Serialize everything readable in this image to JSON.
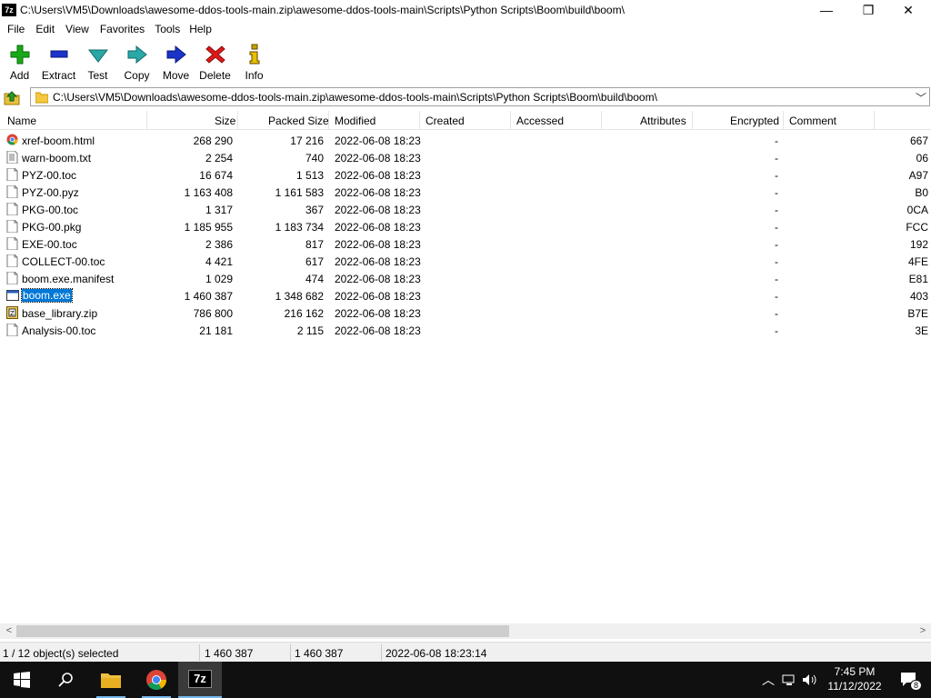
{
  "window": {
    "title": "C:\\Users\\VM5\\Downloads\\awesome-ddos-tools-main.zip\\awesome-ddos-tools-main\\Scripts\\Python Scripts\\Boom\\build\\boom\\",
    "app_icon_text": "7z",
    "minimize": "—",
    "restore": "❐",
    "close": "✕"
  },
  "menu": [
    "File",
    "Edit",
    "View",
    "Favorites",
    "Tools",
    "Help"
  ],
  "toolbar": [
    {
      "label": "Add",
      "icon": "plus-icon",
      "color": "#18a818"
    },
    {
      "label": "Extract",
      "icon": "minus-icon",
      "color": "#1a33c8"
    },
    {
      "label": "Test",
      "icon": "check-icon",
      "color": "#2aa8a8"
    },
    {
      "label": "Copy",
      "icon": "copy-arrow-icon",
      "color": "#2aa8a8"
    },
    {
      "label": "Move",
      "icon": "move-arrow-icon",
      "color": "#1a33c8"
    },
    {
      "label": "Delete",
      "icon": "delete-x-icon",
      "color": "#e01818"
    },
    {
      "label": "Info",
      "icon": "info-icon",
      "color": "#c8a000"
    }
  ],
  "address": {
    "path": "C:\\Users\\VM5\\Downloads\\awesome-ddos-tools-main.zip\\awesome-ddos-tools-main\\Scripts\\Python Scripts\\Boom\\build\\boom\\"
  },
  "columns": [
    "Name",
    "Size",
    "Packed Size",
    "Modified",
    "Created",
    "Accessed",
    "Attributes",
    "Encrypted",
    "Comment"
  ],
  "files": [
    {
      "name": "xref-boom.html",
      "size": "268 290",
      "packed": "17 216",
      "modified": "2022-06-08 18:23",
      "encrypted": "-",
      "crc": "667",
      "icon": "chrome-html-icon"
    },
    {
      "name": "warn-boom.txt",
      "size": "2 254",
      "packed": "740",
      "modified": "2022-06-08 18:23",
      "encrypted": "-",
      "crc": "06",
      "icon": "text-file-icon"
    },
    {
      "name": "PYZ-00.toc",
      "size": "16 674",
      "packed": "1 513",
      "modified": "2022-06-08 18:23",
      "encrypted": "-",
      "crc": "A97",
      "icon": "file-icon"
    },
    {
      "name": "PYZ-00.pyz",
      "size": "1 163 408",
      "packed": "1 161 583",
      "modified": "2022-06-08 18:23",
      "encrypted": "-",
      "crc": "B0",
      "icon": "file-icon"
    },
    {
      "name": "PKG-00.toc",
      "size": "1 317",
      "packed": "367",
      "modified": "2022-06-08 18:23",
      "encrypted": "-",
      "crc": "0CA",
      "icon": "file-icon"
    },
    {
      "name": "PKG-00.pkg",
      "size": "1 185 955",
      "packed": "1 183 734",
      "modified": "2022-06-08 18:23",
      "encrypted": "-",
      "crc": "FCC",
      "icon": "file-icon"
    },
    {
      "name": "EXE-00.toc",
      "size": "2 386",
      "packed": "817",
      "modified": "2022-06-08 18:23",
      "encrypted": "-",
      "crc": "192",
      "icon": "file-icon"
    },
    {
      "name": "COLLECT-00.toc",
      "size": "4 421",
      "packed": "617",
      "modified": "2022-06-08 18:23",
      "encrypted": "-",
      "crc": "4FE",
      "icon": "file-icon"
    },
    {
      "name": "boom.exe.manifest",
      "size": "1 029",
      "packed": "474",
      "modified": "2022-06-08 18:23",
      "encrypted": "-",
      "crc": "E81",
      "icon": "file-icon"
    },
    {
      "name": "boom.exe",
      "size": "1 460 387",
      "packed": "1 348 682",
      "modified": "2022-06-08 18:23",
      "encrypted": "-",
      "crc": "403",
      "icon": "exe-icon",
      "selected": true
    },
    {
      "name": "base_library.zip",
      "size": "786 800",
      "packed": "216 162",
      "modified": "2022-06-08 18:23",
      "encrypted": "-",
      "crc": "B7E",
      "icon": "zip-icon"
    },
    {
      "name": "Analysis-00.toc",
      "size": "21 181",
      "packed": "2 115",
      "modified": "2022-06-08 18:23",
      "encrypted": "-",
      "crc": "3E",
      "icon": "file-icon"
    }
  ],
  "status": {
    "selection": "1 / 12 object(s) selected",
    "size": "1 460 387",
    "packed": "1 460 387",
    "modified": "2022-06-08 18:23:14"
  },
  "taskbar": {
    "items": [
      "start-icon",
      "search-icon",
      "file-explorer-icon",
      "chrome-icon",
      "7zip-icon"
    ],
    "time": "7:45 PM",
    "date": "11/12/2022",
    "notification_count": "8"
  }
}
